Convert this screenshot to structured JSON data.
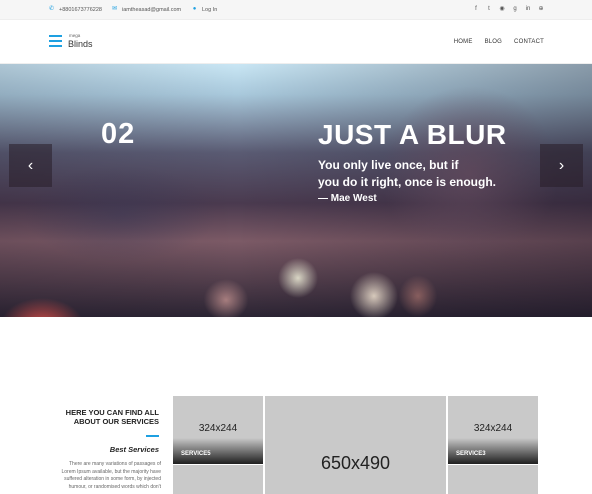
{
  "topbar": {
    "phone": "+8801673776228",
    "email": "iamtheasad@gmail.com",
    "login": "Log In",
    "social_icons": [
      "facebook-icon",
      "twitter-icon",
      "rss-icon",
      "google-plus-icon",
      "linkedin-icon",
      "dribbble-icon"
    ]
  },
  "brand": {
    "small": "mega",
    "name": "Blinds"
  },
  "nav": [
    "HOME",
    "BLOG",
    "CONTACT"
  ],
  "hero": {
    "number": "02",
    "title": "JUST A BLUR",
    "quote_line1": "You only live once, but if",
    "quote_line2": "you do it right, once is enough.",
    "author": "— Mae West",
    "prev_glyph": "‹",
    "next_glyph": "›"
  },
  "services": {
    "heading_line1": "HERE YOU CAN FIND ALL",
    "heading_line2": "ABOUT OUR SERVICES",
    "subheading": "Best Services",
    "desc_line1": "There are many variations of passages of",
    "desc_line2": "Lorem Ipsum available, but the majority have",
    "desc_line3": "suffered alteration in some form, by injected",
    "desc_line4": "humour, or randomised words which don't"
  },
  "tiles": [
    {
      "size": "324x244",
      "label": "SERVICE5"
    },
    {
      "size": "650x490",
      "label": ""
    },
    {
      "size": "324x244",
      "label": "SERVICE3"
    }
  ],
  "colors": {
    "accent": "#1ea0e1",
    "placeholder": "#c9c9c9"
  }
}
